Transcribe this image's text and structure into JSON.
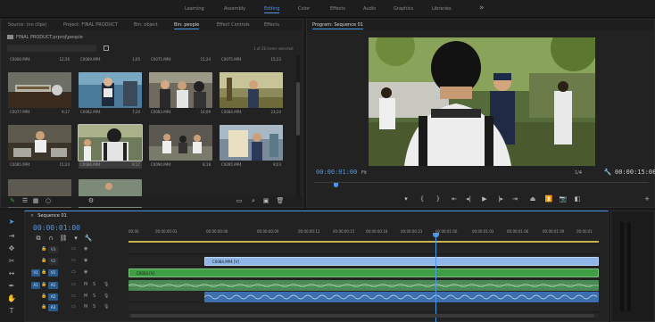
{
  "workspaces": [
    {
      "label": "Learning"
    },
    {
      "label": "Assembly"
    },
    {
      "label": "Editing"
    },
    {
      "label": "Color"
    },
    {
      "label": "Effects"
    },
    {
      "label": "Audio"
    },
    {
      "label": "Graphics"
    },
    {
      "label": "Libraries"
    }
  ],
  "workspaces_more": "»",
  "left_tabs": [
    "Source: (no clips)",
    "Project: FINAL PRODUCT",
    "Bin: object",
    "Bin: people",
    "Effect Controls",
    "Effects"
  ],
  "bin": {
    "path": "FINAL PRODUCT.prproj\\people",
    "items_selected": "1 of 26 items selected",
    "clips": [
      {
        "name": "C0066.MP4",
        "duration": "12;26"
      },
      {
        "name": "C0069.MP4",
        "duration": "1;05"
      },
      {
        "name": "C0075.MP4",
        "duration": "15;24"
      },
      {
        "name": "C0075.MP4",
        "duration": "15;23"
      },
      {
        "name": "C0077.MP4",
        "duration": "9;17"
      },
      {
        "name": "C0082.MP4",
        "duration": "7;20"
      },
      {
        "name": "C0083.MP4",
        "duration": "16;09"
      },
      {
        "name": "C0084.MP4",
        "duration": "23;24"
      },
      {
        "name": "C0085.MP4",
        "duration": "15;24"
      },
      {
        "name": "C0086.MP4",
        "duration": "9;17"
      },
      {
        "name": "C0090.MP4",
        "duration": "8;18"
      },
      {
        "name": "C0095.MP4",
        "duration": "9;03"
      }
    ]
  },
  "program": {
    "tab": "Program: Sequence 01",
    "timecode": "00:00:01:00",
    "fit": "Fit",
    "resolution": "1/4",
    "duration": "00:00:15:08"
  },
  "timeline": {
    "sequence": "Sequence 01",
    "timecode": "00:00:01:00",
    "ruler": [
      "00:00",
      "00:00:00:03",
      "00:00:00:06",
      "00:00:00:09",
      "00:00:00:12",
      "00:00:00:15",
      "00:00:00:18",
      "00:00:00:21",
      "00:00:01:00",
      "00:00:01:03",
      "00:00:01:06",
      "00:00:01:09",
      "00:00:01"
    ],
    "tracks": [
      {
        "id": "V3",
        "src": ""
      },
      {
        "id": "V2",
        "src": ""
      },
      {
        "id": "V1",
        "src": "V1"
      },
      {
        "id": "A1",
        "src": "A1"
      },
      {
        "id": "A2",
        "src": ""
      },
      {
        "id": "A3",
        "src": ""
      }
    ],
    "clips": [
      {
        "track": "V2",
        "label": "C0084.MP4 [V]"
      },
      {
        "track": "V1",
        "label": "C0054 [V]"
      }
    ],
    "track_letters": {
      "m": "M",
      "s": "S"
    }
  },
  "colors": {
    "accent": "#4f98e8",
    "video_clip": "#8fb6e6",
    "green_clip": "#3f9d43",
    "work_area": "#c8b04a"
  }
}
